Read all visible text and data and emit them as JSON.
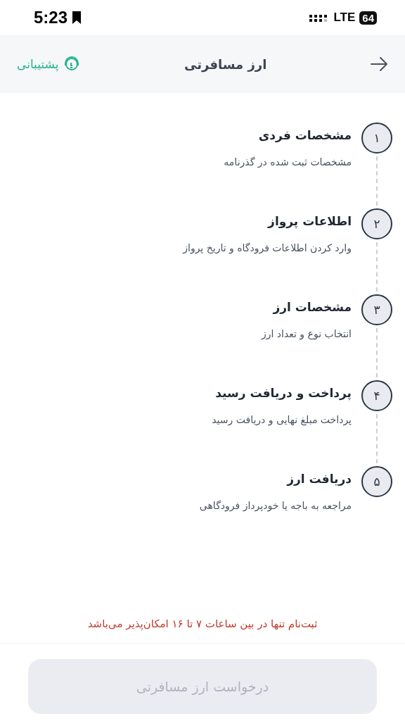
{
  "status_bar": {
    "time": "5:23",
    "network": "LTE",
    "battery": "64"
  },
  "header": {
    "title": "ارز مسافرتی",
    "support": "پشتیبانی"
  },
  "steps": [
    {
      "number": "۱",
      "title": "مشخصات فردی",
      "subtitle": "مشخصات ثبت شده در گذرنامه"
    },
    {
      "number": "۲",
      "title": "اطلاعات پرواز",
      "subtitle": "وارد کردن اطلاعات فرودگاه و تاریخ پرواز"
    },
    {
      "number": "۳",
      "title": "مشخصات ارز",
      "subtitle": "انتخاب نوع و تعداد ارز"
    },
    {
      "number": "۴",
      "title": "پرداخت و دریافت رسید",
      "subtitle": "پرداخت مبلغ نهایی و دریافت رسید"
    },
    {
      "number": "۵",
      "title": "دریافت ارز",
      "subtitle": "مراجعه به باجه یا خودپرداز فرودگاهی"
    }
  ],
  "notice": "ثبت‌نام تنها در بین ساعات ۷ تا ۱۶ امکان‌پذیر می‌باشد",
  "submit": {
    "label": "درخواست ارز مسافرتی",
    "disabled": true
  }
}
